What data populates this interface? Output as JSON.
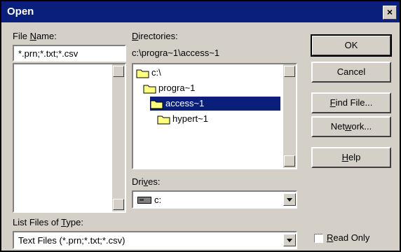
{
  "window": {
    "title": "Open",
    "close_label": "×"
  },
  "file_name": {
    "label": "File Name:",
    "value": "*.prn;*.txt;*.csv"
  },
  "directories": {
    "label": "Directories:",
    "path": "c:\\progra~1\\access~1",
    "items": [
      {
        "label": "c:\\",
        "selected": false
      },
      {
        "label": "progra~1",
        "selected": false
      },
      {
        "label": "access~1",
        "selected": true
      },
      {
        "label": "hypert~1",
        "selected": false
      }
    ]
  },
  "drives": {
    "label": "Drives:",
    "value": "c:"
  },
  "list_type": {
    "label": "List Files of Type:",
    "value": "Text Files (*.prn;*.txt;*.csv)"
  },
  "buttons": {
    "ok": "OK",
    "cancel": "Cancel",
    "find_file": "Find File...",
    "network": "Network...",
    "help": "Help"
  },
  "read_only": {
    "label": "Read Only",
    "checked": false
  }
}
